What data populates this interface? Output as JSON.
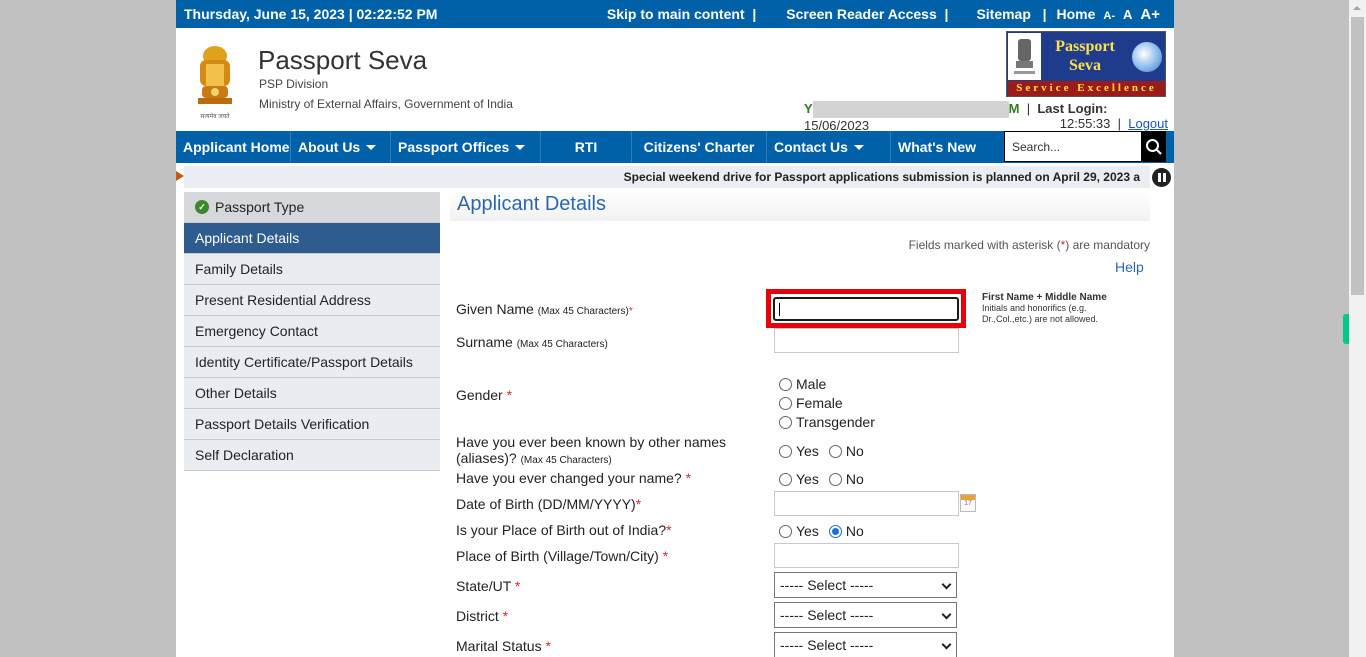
{
  "topbar": {
    "date": "Thursday,  June  15, 2023 | 02:22:52 PM",
    "skip": "Skip to main content  |",
    "screen_reader": "Screen Reader Access  |",
    "sitemap": "Sitemap   |",
    "home": "Home",
    "font_small": "A-",
    "font_normal": "A",
    "font_large": "A+"
  },
  "header": {
    "title": "Passport Seva",
    "division": "PSP Division",
    "ministry": "Ministry of External Affairs, Government of India",
    "emblem_caption": "सत्यमेव जयते",
    "brand_line1": "Passport",
    "brand_line2": "Seva",
    "brand_tagline": "Service Excellence",
    "welcome_prefix": "Y",
    "welcome_suffix": "M",
    "last_login_label": "Last Login:",
    "last_login_date": "15/06/2023",
    "last_login_time": "12:55:33",
    "logout": "Logout"
  },
  "nav": {
    "items": [
      {
        "label": "Applicant Home",
        "dropdown": false
      },
      {
        "label": "About Us",
        "dropdown": true
      },
      {
        "label": "Passport Offices",
        "dropdown": true
      },
      {
        "label": "RTI",
        "dropdown": false
      },
      {
        "label": "Citizens' Charter",
        "dropdown": false
      },
      {
        "label": "Contact Us",
        "dropdown": true
      },
      {
        "label": "What's New",
        "dropdown": false
      }
    ],
    "search_placeholder": "Search..."
  },
  "ticker": {
    "text": "Special weekend drive for Passport applications submission is planned on April 29, 2023 a"
  },
  "sidebar": {
    "items": [
      {
        "label": "Passport Type",
        "state": "completed"
      },
      {
        "label": "Applicant Details",
        "state": "active"
      },
      {
        "label": "Family Details",
        "state": "pending"
      },
      {
        "label": "Present Residential Address",
        "state": "pending"
      },
      {
        "label": "Emergency Contact",
        "state": "pending"
      },
      {
        "label": "Identity Certificate/Passport Details",
        "state": "pending"
      },
      {
        "label": "Other Details",
        "state": "pending"
      },
      {
        "label": "Passport Details Verification",
        "state": "pending"
      },
      {
        "label": "Self Declaration",
        "state": "pending"
      }
    ]
  },
  "main": {
    "title": "Applicant Details",
    "mandatory_note_pre": "Fields marked with asterisk (",
    "mandatory_note_star": "*",
    "mandatory_note_post": ") are mandatory",
    "help": "Help",
    "given_name": {
      "label": "Given Name",
      "hint": "(Max 45 Characters)",
      "value": ""
    },
    "given_name_help_title": "First Name + Middle Name",
    "given_name_help_text": "Initials and honorifics (e.g. Dr.,Col.,etc.) are not allowed.",
    "surname": {
      "label": "Surname",
      "hint": "(Max 45 Characters)",
      "value": ""
    },
    "gender": {
      "label": "Gender",
      "options": [
        "Male",
        "Female",
        "Transgender"
      ],
      "selected": null
    },
    "aliases": {
      "label_line1": "Have you ever been known by other names",
      "label_line2": "(aliases)?",
      "hint": "(Max 45 Characters)",
      "options": [
        "Yes",
        "No"
      ],
      "selected": null
    },
    "changed_name": {
      "label": "Have you ever changed your name?",
      "options": [
        "Yes",
        "No"
      ],
      "selected": null
    },
    "dob": {
      "label": "Date of Birth (DD/MM/YYYY)",
      "value": "",
      "calendar_day": "17"
    },
    "birth_out_india": {
      "label": "Is your Place of Birth out of India?",
      "options": [
        "Yes",
        "No"
      ],
      "selected": "No"
    },
    "place_of_birth": {
      "label": "Place of Birth (Village/Town/City)",
      "value": ""
    },
    "state": {
      "label": "State/UT",
      "selected": "----- Select -----"
    },
    "district": {
      "label": "District",
      "selected": "----- Select -----"
    },
    "marital_status": {
      "label": "Marital Status",
      "selected": "----- Select -----"
    },
    "required_star": "*"
  },
  "colors": {
    "brand_blue": "#0061a8",
    "active_step": "#2e5c8e",
    "focus_highlight": "#e8000b",
    "required": "#d52b2b"
  }
}
